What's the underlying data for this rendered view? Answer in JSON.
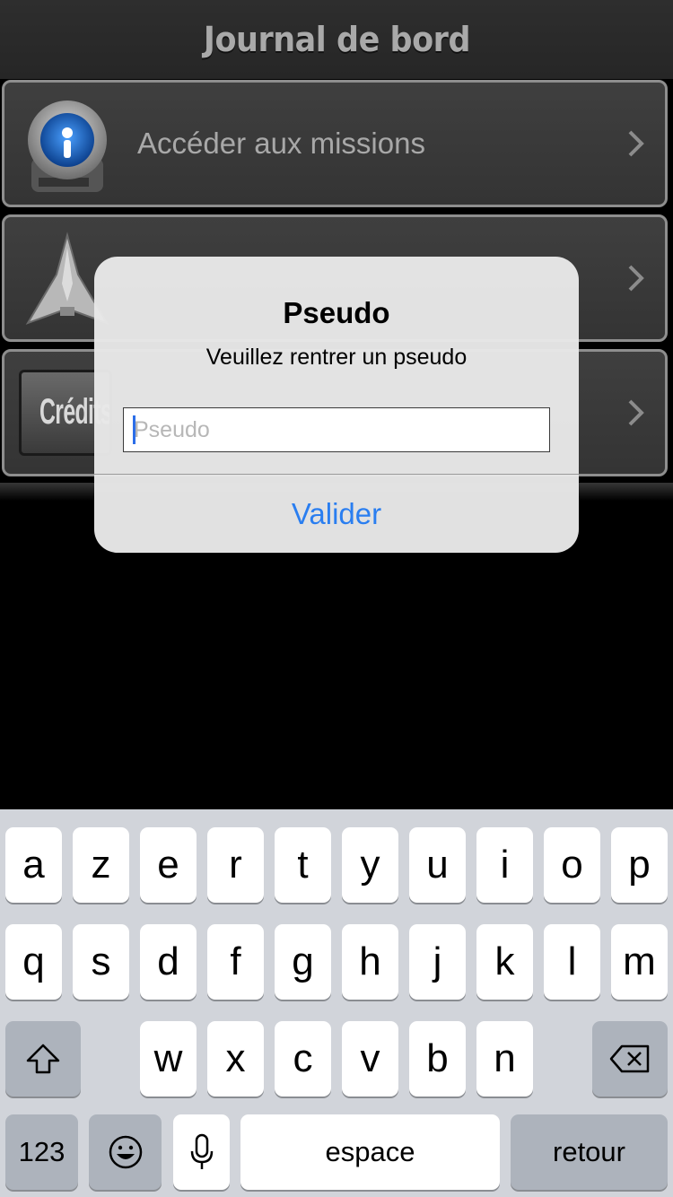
{
  "header": {
    "title": "Journal de bord"
  },
  "menu": {
    "items": [
      {
        "label": "Accéder aux missions"
      },
      {
        "label": ""
      },
      {
        "label": ""
      }
    ],
    "credits_text": "Crédits"
  },
  "alert": {
    "title": "Pseudo",
    "message": "Veuillez rentrer un pseudo",
    "input_placeholder": "Pseudo",
    "input_value": "",
    "button_label": "Valider",
    "button_color": "#2a7ef0"
  },
  "keyboard": {
    "row1": [
      "a",
      "z",
      "e",
      "r",
      "t",
      "y",
      "u",
      "i",
      "o",
      "p"
    ],
    "row2": [
      "q",
      "s",
      "d",
      "f",
      "g",
      "h",
      "j",
      "k",
      "l",
      "m"
    ],
    "row3": [
      "w",
      "x",
      "c",
      "v",
      "b",
      "n"
    ],
    "numbers_label": "123",
    "space_label": "espace",
    "return_label": "retour"
  },
  "icons": [
    "podcast-icon",
    "spaceship-icon",
    "chevron-right-icon",
    "shift-icon",
    "delete-icon",
    "emoji-icon",
    "microphone-icon"
  ]
}
